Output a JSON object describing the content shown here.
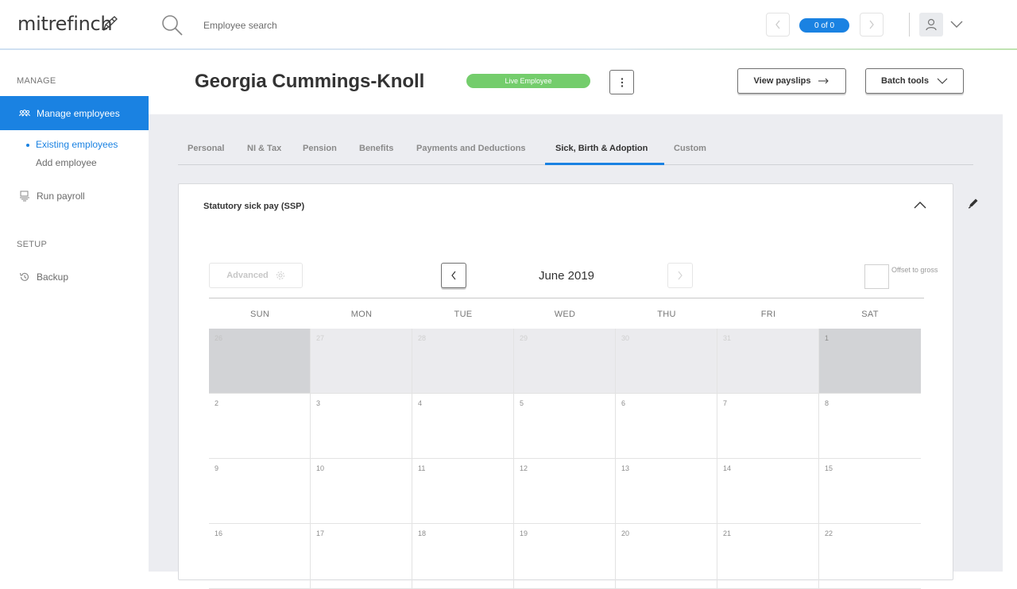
{
  "app": {
    "logo_text": "mitrefinch"
  },
  "search": {
    "placeholder": "Employee search",
    "value": ""
  },
  "pager": {
    "count_label": "0 of 0"
  },
  "sidebar": {
    "manage_heading": "MANAGE",
    "manage_employees_label": "Manage employees",
    "existing_employees_label": "Existing employees",
    "add_employee_label": "Add employee",
    "run_payroll_label": "Run payroll",
    "setup_heading": "SETUP",
    "backup_label": "Backup"
  },
  "employee": {
    "name": "Georgia Cummings-Knoll",
    "status": "Live Employee",
    "status_color": "#74cd6c"
  },
  "header": {
    "more_label": "⋮",
    "view_payslips_label": "View payslips",
    "batch_tools_label": "Batch tools"
  },
  "tabs": [
    {
      "label": "Personal"
    },
    {
      "label": "NI & Tax"
    },
    {
      "label": "Pension"
    },
    {
      "label": "Benefits"
    },
    {
      "label": "Payments and Deductions"
    },
    {
      "label": "Sick, Birth & Adoption",
      "active": true
    },
    {
      "label": "Custom"
    }
  ],
  "ssp": {
    "title": "Statutory sick pay (SSP)",
    "advanced_label": "Advanced",
    "month_label": "June 2019",
    "offset_label": "Offset to gross",
    "offset_checked": false
  },
  "calendar": {
    "days_of_week": [
      "SUN",
      "MON",
      "TUE",
      "WED",
      "THU",
      "FRI",
      "SAT"
    ],
    "weeks": [
      [
        "26",
        "27",
        "28",
        "29",
        "30",
        "31",
        "1"
      ],
      [
        "2",
        "3",
        "4",
        "5",
        "6",
        "7",
        "8"
      ],
      [
        "9",
        "10",
        "11",
        "12",
        "13",
        "14",
        "15"
      ],
      [
        "16",
        "17",
        "18",
        "19",
        "20",
        "21",
        "22"
      ]
    ],
    "out_of_month": [
      [
        0,
        0
      ],
      [
        0,
        1
      ],
      [
        0,
        2
      ],
      [
        0,
        3
      ],
      [
        0,
        4
      ],
      [
        0,
        5
      ]
    ],
    "accent_color": "#1a82e2"
  }
}
